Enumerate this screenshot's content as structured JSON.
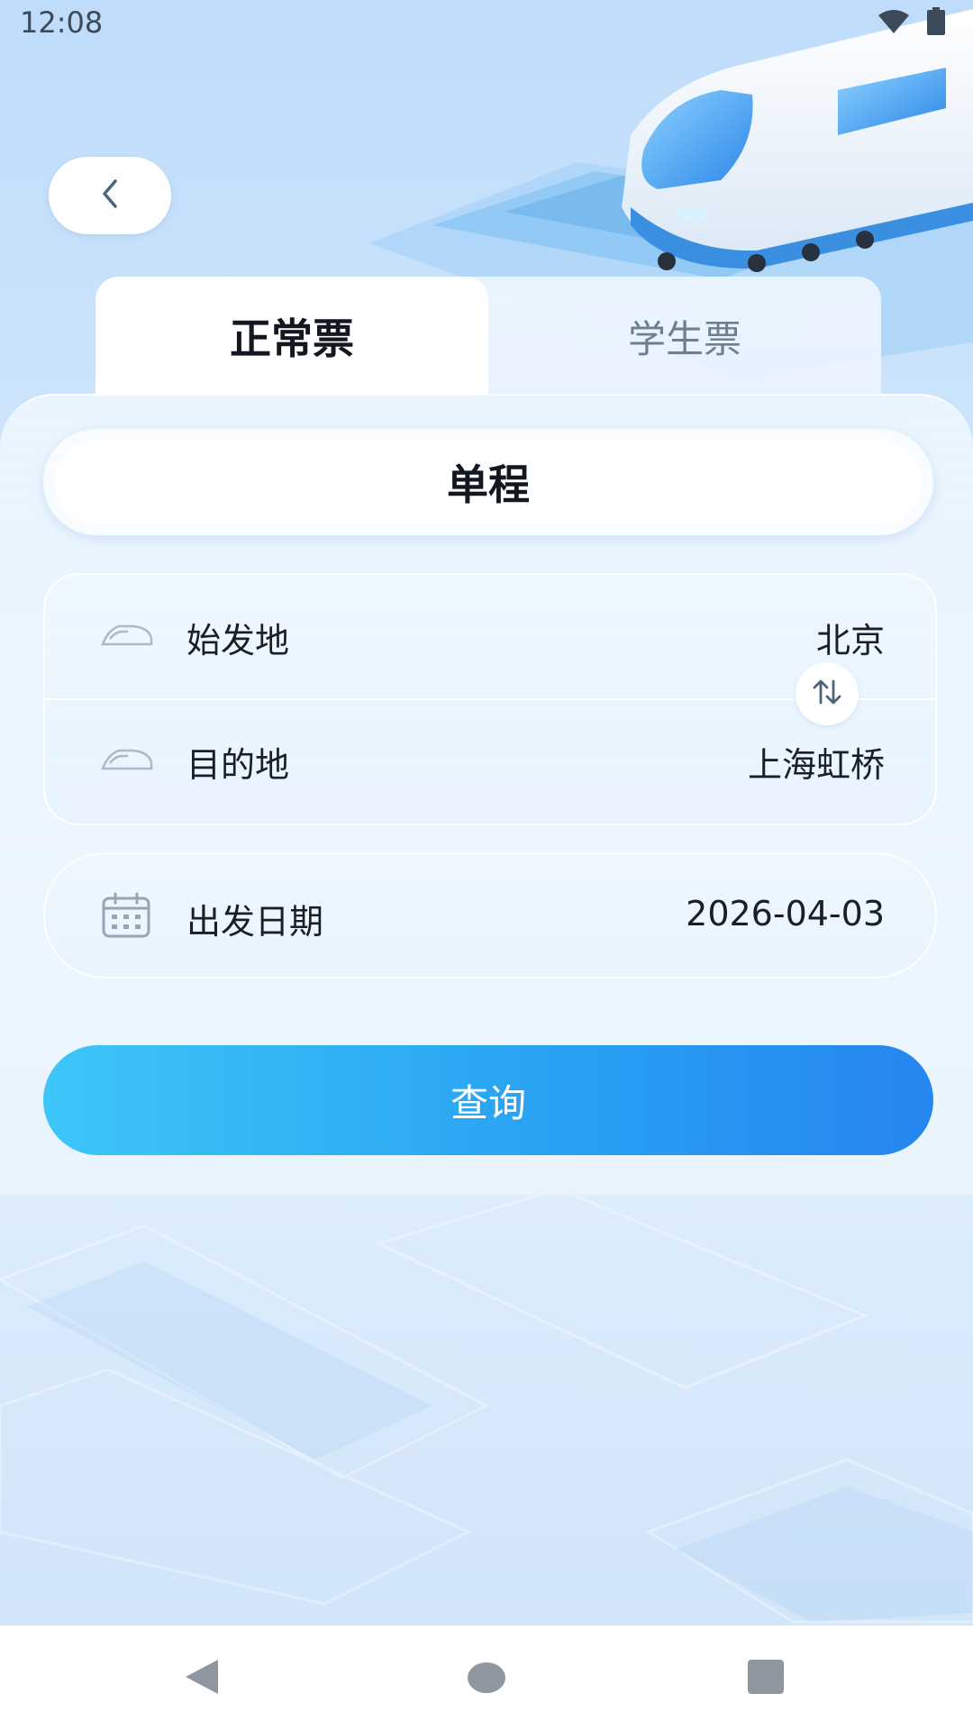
{
  "status_bar": {
    "time": "12:08",
    "icons": [
      "wifi-icon",
      "battery-icon"
    ]
  },
  "header": {
    "back_icon": "chevron-left-icon"
  },
  "tabs": [
    {
      "label": "正常票",
      "active": true
    },
    {
      "label": "学生票",
      "active": false
    }
  ],
  "trip_type": {
    "label": "单程"
  },
  "route": {
    "origin": {
      "label": "始发地",
      "value": "北京",
      "icon": "train-icon"
    },
    "destination": {
      "label": "目的地",
      "value": "上海虹桥",
      "icon": "train-icon"
    },
    "swap_icon": "swap-arrows-icon"
  },
  "date": {
    "label": "出发日期",
    "value": "2026-04-03",
    "icon": "calendar-icon"
  },
  "query_button": {
    "label": "查询"
  },
  "colors": {
    "accent_start": "#3ec6f8",
    "accent_end": "#2586ef",
    "text_primary": "#111820",
    "text_inactive": "#6f7f8e"
  },
  "nav_bar": {
    "back": "nav-back-icon",
    "home": "nav-home-icon",
    "recent": "nav-recent-icon"
  }
}
